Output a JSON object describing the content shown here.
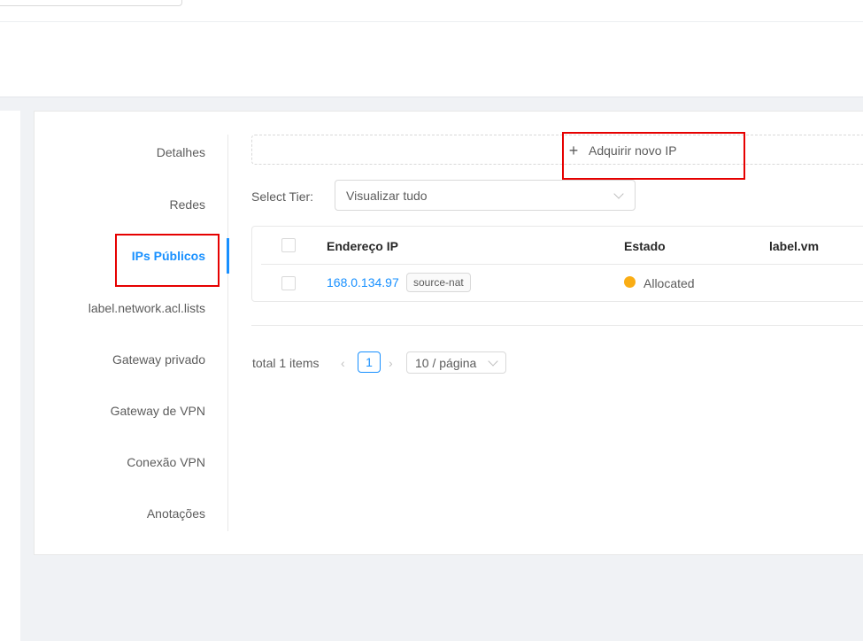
{
  "side_tabs": [
    {
      "label": "Detalhes",
      "active": false
    },
    {
      "label": "Redes",
      "active": false
    },
    {
      "label": "IPs Públicos",
      "active": true
    },
    {
      "label": "label.network.acl.lists",
      "active": false
    },
    {
      "label": "Gateway privado",
      "active": false
    },
    {
      "label": "Gateway de VPN",
      "active": false
    },
    {
      "label": "Conexão VPN",
      "active": false
    },
    {
      "label": "Anotações",
      "active": false
    }
  ],
  "acquire": {
    "icon": "plus-icon",
    "label": "Adquirir novo IP"
  },
  "tier_filter": {
    "label": "Select Tier:",
    "value": "Visualizar tudo"
  },
  "table": {
    "columns": [
      "Endereço IP",
      "Estado",
      "label.vm"
    ],
    "rows": [
      {
        "ip": "168.0.134.97",
        "tag": "source-nat",
        "state": "Allocated",
        "state_color": "#faad14",
        "vm": ""
      }
    ]
  },
  "pagination": {
    "total_text": "total 1 items",
    "current_page": "1",
    "prev_icon": "‹",
    "next_icon": "›",
    "page_size": "10 / página"
  },
  "colors": {
    "accent": "#1890ff",
    "highlight": "#e60000",
    "status_allocated": "#faad14"
  }
}
